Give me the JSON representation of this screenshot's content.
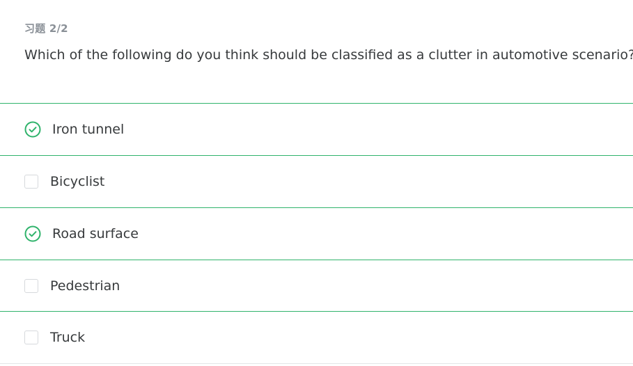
{
  "header": {
    "label": "习题 2/2"
  },
  "question": {
    "text": "Which of the following do you think should be classified as a clutter in automotive scenario?"
  },
  "options": [
    {
      "label": "Iron tunnel",
      "selected": true,
      "icon": "check-circle-icon"
    },
    {
      "label": "Bicyclist",
      "selected": false,
      "icon": "checkbox"
    },
    {
      "label": "Road surface",
      "selected": true,
      "icon": "check-circle-icon"
    },
    {
      "label": "Pedestrian",
      "selected": false,
      "icon": "checkbox"
    },
    {
      "label": "Truck",
      "selected": false,
      "icon": "checkbox"
    }
  ],
  "colors": {
    "accent_green": "#2fb36b",
    "text": "#373a3c",
    "muted": "#8a9097",
    "divider": "#e4e6e8"
  }
}
